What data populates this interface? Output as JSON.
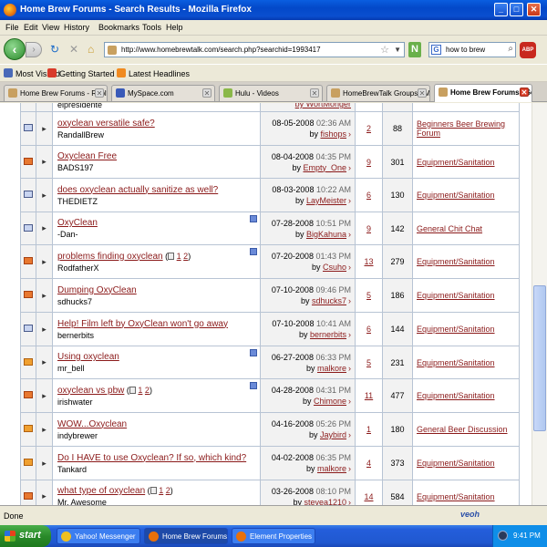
{
  "window": {
    "title": "Home Brew Forums - Search Results - Mozilla Firefox"
  },
  "menu": [
    "File",
    "Edit",
    "View",
    "History",
    "Bookmarks",
    "Tools",
    "Help"
  ],
  "nav": {
    "url": "http://www.homebrewtalk.com/search.php?searchid=1993417",
    "search_query": "how to brew",
    "search_engine_letter": "G",
    "abp_label": "ABP"
  },
  "bookmarks": [
    {
      "label": "Most Visited",
      "color": "#4a6ab8"
    },
    {
      "label": "Getting Started",
      "color": "#d83a2a"
    },
    {
      "label": "Latest Headlines",
      "color": "#f08a20"
    }
  ],
  "tabs": [
    {
      "label": "Home Brew Forums - Reply t...",
      "color": "#c8a060"
    },
    {
      "label": "MySpace.com",
      "color": "#3a5ab8"
    },
    {
      "label": "Hulu - Videos",
      "color": "#8ab848"
    },
    {
      "label": "HomeBrewTalk Groups - Mich...",
      "color": "#c8a060"
    },
    {
      "label": "Home Brew Forums - Se...",
      "color": "#c8a060"
    }
  ],
  "partial_row": {
    "starter": "elpresidente",
    "last_by": "by WortMonger"
  },
  "threads": [
    {
      "title": "oxyclean versatile safe?",
      "starter": "RandallBrew",
      "date": "08-05-2008",
      "time": "02:36 AM",
      "by": "fishops",
      "replies": "2",
      "views": "88",
      "forum": "Beginners Beer Brewing Forum",
      "icon": "normal",
      "mark": "",
      "pages": [],
      "check": false
    },
    {
      "title": "Oxyclean Free",
      "starter": "BADS197",
      "date": "08-04-2008",
      "time": "04:35 PM",
      "by": "Empty_One",
      "replies": "9",
      "views": "301",
      "forum": "Equipment/Sanitation",
      "icon": "hot",
      "mark": "",
      "pages": [],
      "check": false
    },
    {
      "title": "does oxyclean actually sanitize as well?",
      "starter": "THEDIETZ",
      "date": "08-03-2008",
      "time": "10:22 AM",
      "by": "LayMeister",
      "replies": "6",
      "views": "130",
      "forum": "Equipment/Sanitation",
      "icon": "normal",
      "mark": "",
      "pages": [],
      "check": false
    },
    {
      "title": "OxyClean",
      "starter": "-Dan-",
      "date": "07-28-2008",
      "time": "10:51 PM",
      "by": "BigKahuna",
      "replies": "9",
      "views": "142",
      "forum": "General Chit Chat",
      "icon": "normal",
      "mark": "",
      "pages": [],
      "check": true
    },
    {
      "title": "problems finding oxyclean",
      "starter": "RodfatherX",
      "date": "07-20-2008",
      "time": "01:43 PM",
      "by": "Csuho",
      "replies": "13",
      "views": "279",
      "forum": "Equipment/Sanitation",
      "icon": "hot",
      "mark": "",
      "pages": [
        "1",
        "2"
      ],
      "check": true
    },
    {
      "title": "Dumping OxyClean",
      "starter": "sdhucks7",
      "date": "07-10-2008",
      "time": "09:46 PM",
      "by": "sdhucks7",
      "replies": "5",
      "views": "186",
      "forum": "Equipment/Sanitation",
      "icon": "hot",
      "mark": "",
      "pages": [],
      "check": false
    },
    {
      "title": "Help! Film left by OxyClean won't go away",
      "starter": "bernerbits",
      "date": "07-10-2008",
      "time": "10:41 AM",
      "by": "bernerbits",
      "replies": "6",
      "views": "144",
      "forum": "Equipment/Sanitation",
      "icon": "normal",
      "mark": "",
      "pages": [],
      "check": false
    },
    {
      "title": "Using oxyclean",
      "starter": "mr_bell",
      "date": "06-27-2008",
      "time": "06:33 PM",
      "by": "malkore",
      "replies": "5",
      "views": "231",
      "forum": "Equipment/Sanitation",
      "icon": "new",
      "mark": "",
      "pages": [],
      "check": true
    },
    {
      "title": "oxyclean vs pbw",
      "starter": "irishwater",
      "date": "04-28-2008",
      "time": "04:31 PM",
      "by": "Chimone",
      "replies": "11",
      "views": "477",
      "forum": "Equipment/Sanitation",
      "icon": "hot",
      "mark": "",
      "pages": [
        "1",
        "2"
      ],
      "check": true
    },
    {
      "title": "WOW...Oxyclean",
      "starter": "indybrewer",
      "date": "04-16-2008",
      "time": "05:26 PM",
      "by": "Jaybird",
      "replies": "1",
      "views": "180",
      "forum": "General Beer Discussion",
      "icon": "new",
      "mark": "",
      "pages": [],
      "check": false
    },
    {
      "title": "Do I HAVE to use Oxyclean? If so, which kind?",
      "starter": "Tankard",
      "date": "04-02-2008",
      "time": "06:35 PM",
      "by": "malkore",
      "replies": "4",
      "views": "373",
      "forum": "Equipment/Sanitation",
      "icon": "new",
      "mark": "",
      "pages": [],
      "check": false
    },
    {
      "title": "what type of oxyclean",
      "starter": "Mr. Awesome",
      "date": "03-26-2008",
      "time": "08:10 PM",
      "by": "stevea1210",
      "replies": "14",
      "views": "584",
      "forum": "Equipment/Sanitation",
      "icon": "hot",
      "mark": "",
      "pages": [
        "1",
        "2"
      ],
      "check": false
    }
  ],
  "status": {
    "text": "Done",
    "veoh": "veoh"
  },
  "taskbar": {
    "start": "start",
    "tasks": [
      {
        "label": "Yahoo! Messenger",
        "color": "#f0c020"
      },
      {
        "label": "Home Brew Forums - ...",
        "color": "#e8700a"
      },
      {
        "label": "Element Properties",
        "color": "#e8700a"
      }
    ],
    "clock": "9:41 PM"
  }
}
